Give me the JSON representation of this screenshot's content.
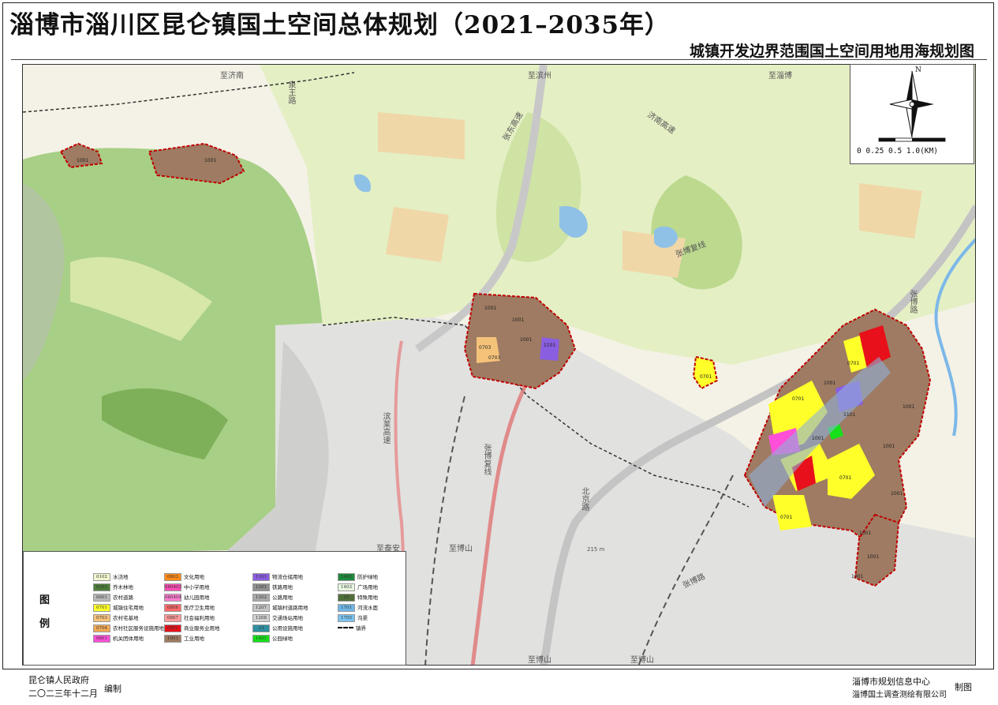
{
  "title": "淄博市淄川区昆仑镇国土空间总体规划（2021–2035年）",
  "subtitle": "城镇开发边界范围国土空间用地用海规划图",
  "scale_bar": "0 0.25 0.5      1.0(KM)",
  "north_label": "N",
  "place_labels": {
    "p1": "至济南",
    "p2": "至滨州",
    "p3": "至淄博",
    "p4": "至泰安",
    "p5": "至博山",
    "p6": "至博山",
    "p7": "至博山",
    "p8": "215 m"
  },
  "road_labels": {
    "r1": "泉王路",
    "r2": "张东高速",
    "r3": "济南高速",
    "r4": "张博复线",
    "r5": "滨莱高速",
    "r6": "张博复线",
    "r7": "北京路",
    "r8": "张博路",
    "r9": "张博路"
  },
  "map_codes": [
    "1001",
    "1001",
    "1001",
    "1001",
    "1001",
    "0703",
    "0703",
    "1101",
    "0701",
    "0701",
    "0701",
    "1001",
    "1001",
    "0701",
    "1001",
    "1001",
    "1101",
    "0701",
    "1001",
    "1001",
    "1001",
    "1001"
  ],
  "legend": {
    "heading_1": "图",
    "heading_2": "例",
    "items": [
      {
        "code": "0102",
        "label": "水浇地",
        "color": "#f3f6cf"
      },
      {
        "code": "0301",
        "label": "乔木林地",
        "color": "#4d7d3c"
      },
      {
        "code": "0601",
        "label": "农村道路",
        "color": "#b8b8b8"
      },
      {
        "code": "0701",
        "label": "城镇住宅用地",
        "color": "#ffff2a"
      },
      {
        "code": "0703",
        "label": "农村宅基地",
        "color": "#f5c27a"
      },
      {
        "code": "0704",
        "label": "农村社区服务设施用地",
        "color": "#f0a955"
      },
      {
        "code": "0801",
        "label": "机关团体用地",
        "color": "#ff4fd8"
      },
      {
        "code": "0803",
        "label": "文化用地",
        "color": "#ff8c1a"
      },
      {
        "code": "080403",
        "label": "中小学用地",
        "color": "#ff4fb5"
      },
      {
        "code": "080404",
        "label": "幼儿园用地",
        "color": "#ff7fd0"
      },
      {
        "code": "0806",
        "label": "医疗卫生用地",
        "color": "#ff6a6a"
      },
      {
        "code": "0807",
        "label": "社会福利用地",
        "color": "#ff9a9a"
      },
      {
        "code": "0901",
        "label": "商业服务业用地",
        "color": "#e8101a"
      },
      {
        "code": "1001",
        "label": "工业用地",
        "color": "#9e7b62"
      },
      {
        "code": "1101",
        "label": "物流仓储用地",
        "color": "#8a5ee0"
      },
      {
        "code": "1201",
        "label": "铁路用地",
        "color": "#8f8f8f"
      },
      {
        "code": "1202",
        "label": "公路用地",
        "color": "#a9a9a9"
      },
      {
        "code": "1207",
        "label": "城镇村道路用地",
        "color": "#c4c4c4"
      },
      {
        "code": "1208",
        "label": "交通场站用地",
        "color": "#d0d0d0"
      },
      {
        "code": "13",
        "label": "公用设施用地",
        "color": "#2f8fa0"
      },
      {
        "code": "1401",
        "label": "公园绿地",
        "color": "#16e01a"
      },
      {
        "code": "1402",
        "label": "防护绿地",
        "color": "#1e8a3c"
      },
      {
        "code": "1403",
        "label": "广场用地",
        "color": "#e8f6e0"
      },
      {
        "code": "15",
        "label": "特殊用地",
        "color": "#4f6e3a"
      },
      {
        "code": "1701",
        "label": "河流水面",
        "color": "#6fb6e6"
      },
      {
        "code": "1705",
        "label": "沟渠",
        "color": "#7cc3ee"
      },
      {
        "code": "",
        "label": "镇界",
        "color": "#000000"
      }
    ]
  },
  "footer": {
    "org_left": "昆仑镇人民政府",
    "date_left": "二〇二三年十二月",
    "made_left": "编制",
    "org_right_1": "淄博市规划信息中心",
    "org_right_2": "淄博国土调查测绘有限公司",
    "made_right": "制图"
  }
}
